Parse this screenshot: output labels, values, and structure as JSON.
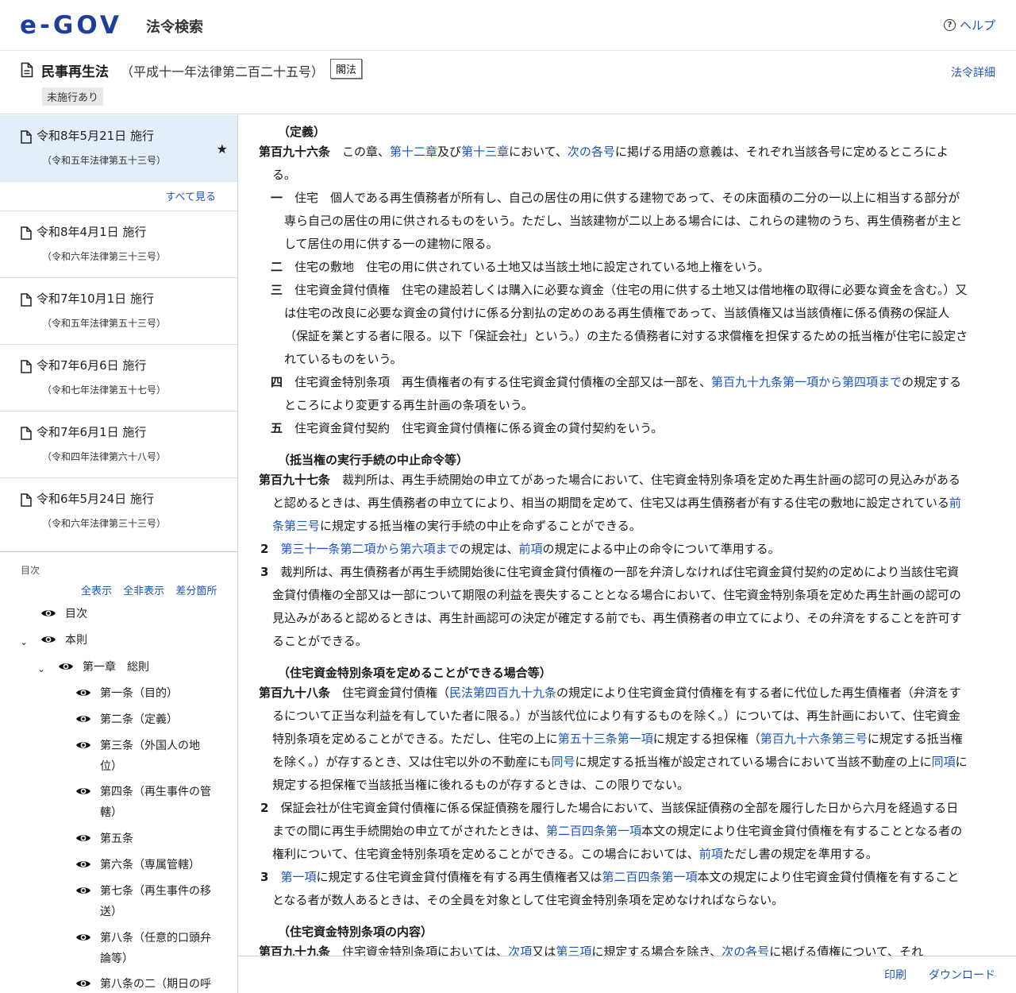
{
  "header": {
    "logo_text": "e-GOV",
    "service_title": "法令検索",
    "help_label": "ヘルプ"
  },
  "law": {
    "name": "民事再生法",
    "number": "（平成十一年法律第二百二十五号）",
    "badge": "閣法",
    "status_tag": "未施行あり",
    "detail_link": "法令詳細"
  },
  "versions": [
    {
      "date": "令和8年5月21日 施行",
      "law": "（令和五年法律第五十三号）",
      "starred": true
    },
    {
      "date": "令和8年4月1日 施行",
      "law": "（令和六年法律第三十三号）"
    },
    {
      "date": "令和7年10月1日 施行",
      "law": "（令和五年法律第五十三号）"
    },
    {
      "date": "令和7年6月6日 施行",
      "law": "（令和七年法律第五十七号）"
    },
    {
      "date": "令和7年6月1日 施行",
      "law": "（令和四年法律第六十八号）"
    },
    {
      "date": "令和6年5月24日 施行",
      "law": "（令和六年法律第三十三号）"
    }
  ],
  "see_all": "すべて見る",
  "toc": {
    "label": "目次",
    "actions": [
      "全表示",
      "全非表示",
      "差分箇所"
    ],
    "items": [
      {
        "label": "目次"
      },
      {
        "label": "本則"
      },
      {
        "label": "第一章　総則"
      },
      {
        "label": "第一条（目的）"
      },
      {
        "label": "第二条（定義）"
      },
      {
        "label": "第三条（外国人の地位）"
      },
      {
        "label": "第四条（再生事件の管轄）"
      },
      {
        "label": "第五条"
      },
      {
        "label": "第六条（専属管轄）"
      },
      {
        "label": "第七条（再生事件の移送）"
      },
      {
        "label": "第八条（任意的口頭弁論等）"
      },
      {
        "label": "第八条の二（期日の呼"
      }
    ]
  },
  "content": {
    "a196_caption": "（定義）",
    "a196_num": "第百九十六条",
    "a196_text": [
      "　この章、",
      "第十二章",
      "及び",
      "第十三章",
      "において、",
      "次の各号",
      "に掲げる用語の意義は、それぞれ当該各号に定めるところによる。"
    ],
    "a196_items": [
      {
        "num": "一",
        "text": "　住宅　個人である再生債務者が所有し、自己の居住の用に供する建物であって、その床面積の二分の一以上に相当する部分が専ら自己の居住の用に供されるものをいう。ただし、当該建物が二以上ある場合には、これらの建物のうち、再生債務者が主として居住の用に供する一の建物に限る。"
      },
      {
        "num": "二",
        "text": "　住宅の敷地　住宅の用に供されている土地又は当該土地に設定されている地上権をいう。"
      },
      {
        "num": "三",
        "text": "　住宅資金貸付債権　住宅の建設若しくは購入に必要な資金（住宅の用に供する土地又は借地権の取得に必要な資金を含む。）又は住宅の改良に必要な資金の貸付けに係る分割払の定めのある再生債権であって、当該債権又は当該債権に係る債務の保証人（保証を業とする者に限る。以下「保証会社」という。）の主たる債務者に対する求償権を担保するための抵当権が住宅に設定されているものをいう。"
      },
      {
        "num": "四",
        "pre": "　住宅資金特別条項　再生債権者の有する住宅資金貸付債権の全部又は一部を、",
        "link": "第百九十九条第一項から第四項まで",
        "post": "の規定するところにより変更する再生計画の条項をいう。"
      },
      {
        "num": "五",
        "text": "　住宅資金貸付契約　住宅資金貸付債権に係る資金の貸付契約をいう。"
      }
    ],
    "a197_caption": "（抵当権の実行手続の中止命令等）",
    "a197_num": "第百九十七条",
    "a197_p1_pre": "　裁判所は、再生手続開始の申立てがあった場合において、住宅資金特別条項を定めた再生計画の認可の見込みがあると認めるときは、再生債務者の申立てにより、相当の期間を定めて、住宅又は再生債務者が有する住宅の敷地に設定されている",
    "a197_p1_link": "前条第三号",
    "a197_p1_post": "に規定する抵当権の実行手続の中止を命ずることができる。",
    "a197_p2_num": "2",
    "a197_p2_link1": "第三十一条第二項から第六項まで",
    "a197_p2_mid": "の規定は、",
    "a197_p2_link2": "前項",
    "a197_p2_post": "の規定による中止の命令について準用する。",
    "a197_p3_num": "3",
    "a197_p3_text": "　裁判所は、再生債務者が再生手続開始後に住宅資金貸付債権の一部を弁済しなければ住宅資金貸付契約の定めにより当該住宅資金貸付債権の全部又は一部について期限の利益を喪失することとなる場合において、住宅資金特別条項を定めた再生計画の認可の見込みがあると認めるときは、再生計画認可の決定が確定する前でも、再生債務者の申立てにより、その弁済をすることを許可することができる。",
    "a198_caption": "（住宅資金特別条項を定めることができる場合等）",
    "a198_num": "第百九十八条",
    "a198_p1": [
      "　住宅資金貸付債権（",
      "民法第四百九十九条",
      "の規定により住宅資金貸付債権を有する者に代位した再生債権者（弁済をするについて正当な利益を有していた者に限る。）が当該代位により有するものを除く。）については、再生計画において、住宅資金特別条項を定めることができる。ただし、住宅の上に",
      "第五十三条第一項",
      "に規定する担保権（",
      "第百九十六条第三号",
      "に規定する抵当権を除く。）が存するとき、又は住宅以外の不動産にも",
      "同号",
      "に規定する抵当権が設定されている場合において当該不動産の上に",
      "同項",
      "に規定する担保権で当該抵当権に後れるものが存するときは、この限りでない。"
    ],
    "a198_p2_num": "2",
    "a198_p2": [
      "　保証会社が住宅資金貸付債権に係る保証債務を履行した場合において、当該保証債務の全部を履行した日から六月を経過する日までの間に再生手続開始の申立てがされたときは、",
      "第二百四条第一項",
      "本文の規定により住宅資金貸付債権を有することとなる者の権利について、住宅資金特別条項を定めることができる。この場合においては、",
      "前項",
      "ただし書の規定を準用する。"
    ],
    "a198_p3_num": "3",
    "a198_p3": [
      "　",
      "第一項",
      "に規定する住宅資金貸付債権を有する再生債権者又は",
      "第二百四条第一項",
      "本文の規定により住宅資金貸付債権を有することとなる者が数人あるときは、その全員を対象として住宅資金特別条項を定めなければならない。"
    ],
    "a199_caption": "（住宅資金特別条項の内容）",
    "a199_num": "第百九十九条",
    "a199_text": [
      "　住宅資金特別条項においては、",
      "次項",
      "又は",
      "第三項",
      "に規定する場合を除き、",
      "次の各号",
      "に掲げる債権について、それ"
    ]
  },
  "footer": {
    "print_label": "印刷",
    "download_label": "ダウンロード"
  }
}
